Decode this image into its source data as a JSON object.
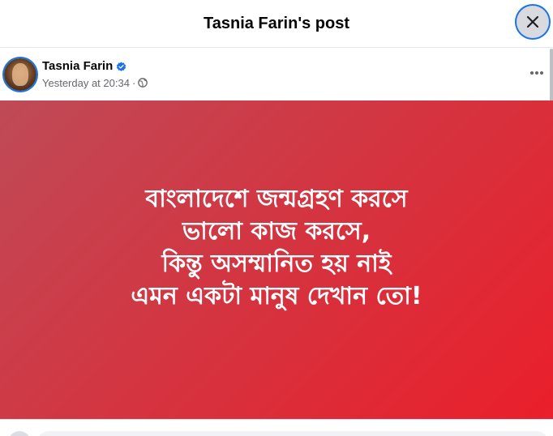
{
  "dialog": {
    "title": "Tasnia Farin's post"
  },
  "post": {
    "author": "Tasnia Farin",
    "timestamp": "Yesterday at 20:34",
    "separator": "·",
    "privacy_icon": "globe-icon",
    "verified_icon": "verified-badge-icon",
    "image_text_lines": [
      "বাংলাদেশে জন্মগ্রহণ করসে",
      "ভালো কাজ করসে,",
      "কিন্তু অসম্মানিত হয় নাই",
      "এমন একটা মানুষ দেখান তো!"
    ]
  },
  "colors": {
    "accent": "#1b74e4",
    "image_gradient_start": "#bf4a57",
    "image_gradient_end": "#ea1f2b"
  }
}
